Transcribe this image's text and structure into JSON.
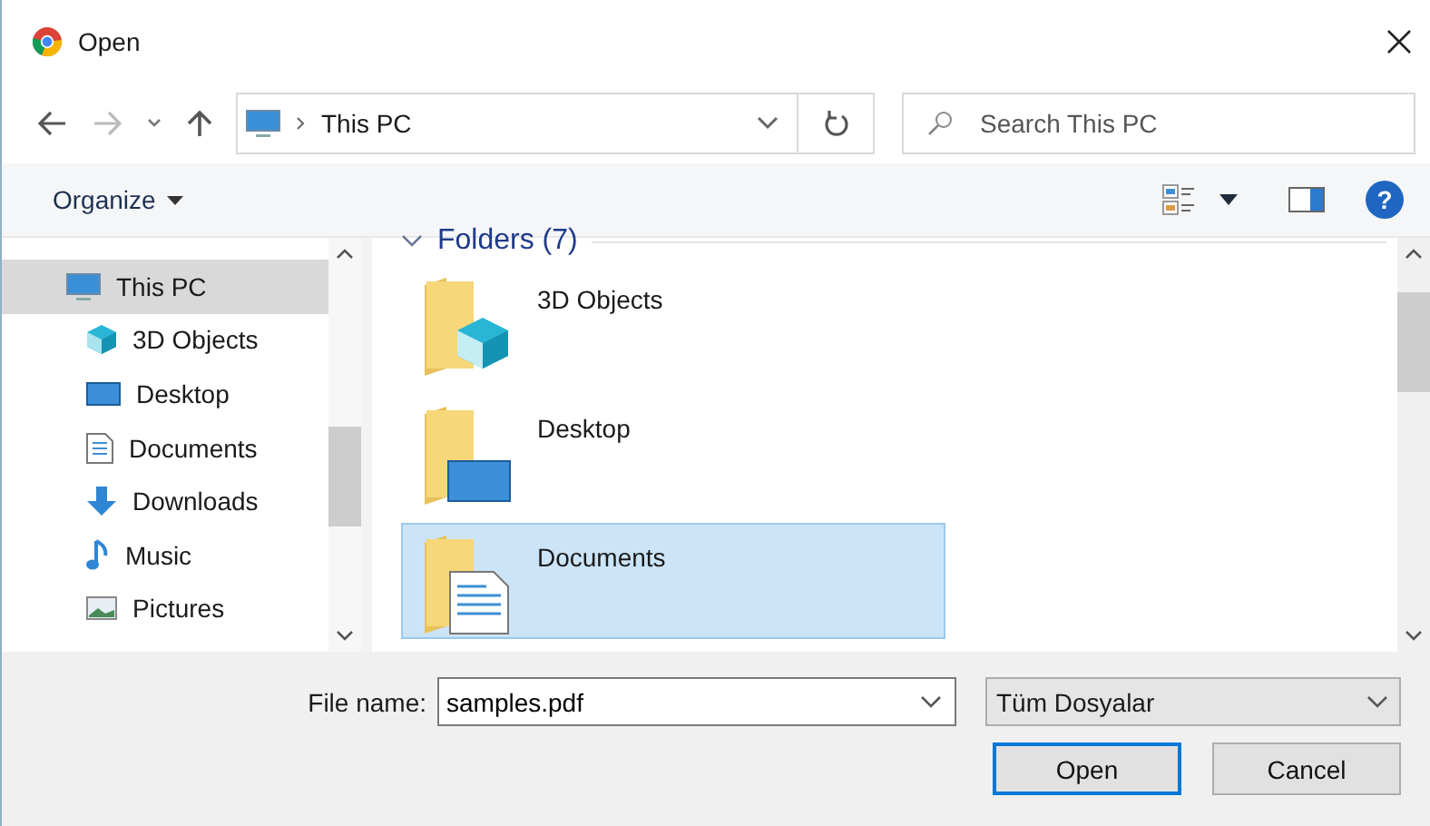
{
  "window": {
    "title": "Open"
  },
  "address": {
    "path": "This PC"
  },
  "search": {
    "placeholder": "Search This PC"
  },
  "toolbar": {
    "organize": "Organize",
    "help": "?"
  },
  "sidebar": {
    "items": [
      {
        "label": "This PC",
        "kind": "pc",
        "selected": true,
        "children": [
          {
            "label": "3D Objects",
            "kind": "objects3d",
            "selected": false
          },
          {
            "label": "Desktop",
            "kind": "desktop",
            "selected": false
          },
          {
            "label": "Documents",
            "kind": "documents",
            "selected": false
          },
          {
            "label": "Downloads",
            "kind": "downloads",
            "selected": false
          },
          {
            "label": "Music",
            "kind": "music",
            "selected": false
          },
          {
            "label": "Pictures",
            "kind": "pictures",
            "selected": false
          }
        ]
      }
    ]
  },
  "content": {
    "group": {
      "title": "Folders (7)",
      "expanded": true
    },
    "folders": [
      {
        "label": "3D Objects",
        "kind": "objects3d",
        "selected": false
      },
      {
        "label": "Desktop",
        "kind": "desktop",
        "selected": false
      },
      {
        "label": "Documents",
        "kind": "documents",
        "selected": true
      }
    ]
  },
  "footer": {
    "file_name_label": "File name:",
    "file_name": "samples.pdf",
    "file_type": "Tüm Dosyalar",
    "buttons": [
      {
        "label": "Open",
        "kind": "default"
      },
      {
        "label": "Cancel",
        "kind": "normal"
      }
    ]
  }
}
